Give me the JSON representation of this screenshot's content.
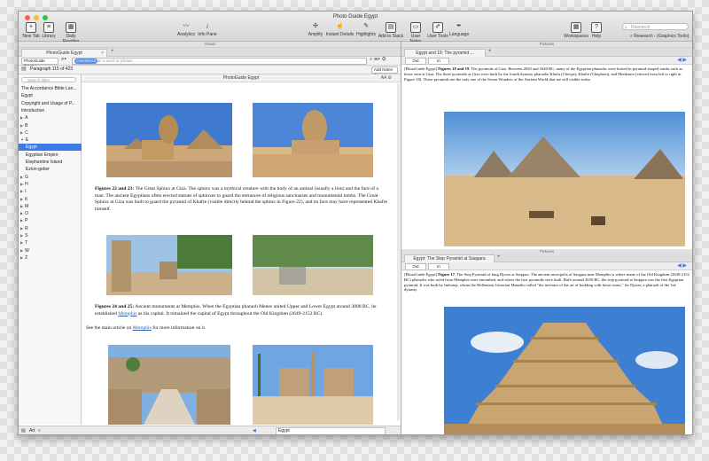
{
  "window": {
    "title": "Photo Guide Egypt"
  },
  "toolbar": {
    "new_tab": "New Tab",
    "library": "Library",
    "daily_reading": "Daily Reading",
    "analytics": "Analytics",
    "info_pane": "Info Pane",
    "amplify": "Amplify",
    "instant_details": "Instant Details",
    "highlights": "Highlights",
    "add_to_stack": "Add to Stack",
    "user_notes": "User Notes",
    "user_tools": "User Tools",
    "language": "Language",
    "workspaces": "Workspaces",
    "help": "Help",
    "search_placeholder": "Research",
    "research_crumb": "Research - (Graphics Tools)"
  },
  "left_band": "Visual",
  "right_band": "Pictures",
  "tab": {
    "label": "PhotoGuide Egypt"
  },
  "searchbar": {
    "module": "PhotoGuide Egypt",
    "scope": "CONTENTS",
    "placeholder": "Enter a word or phrase"
  },
  "location": {
    "text": "Paragraph 115 of 423",
    "add_notes": "Add Notes"
  },
  "sidebar": {
    "search": "Search titles",
    "items": [
      {
        "label": "The Accordance Bible Lan...",
        "arrow": ""
      },
      {
        "label": "Egypt",
        "arrow": ""
      },
      {
        "label": "Copyright and Usage of P...",
        "arrow": ""
      },
      {
        "label": "Introduction",
        "arrow": ""
      },
      {
        "label": "A",
        "arrow": "▶"
      },
      {
        "label": "B",
        "arrow": "▶"
      },
      {
        "label": "C",
        "arrow": "▶"
      },
      {
        "label": "E",
        "arrow": "▼"
      },
      {
        "label": "Egypt",
        "arrow": ""
      },
      {
        "label": "Egyptian Empire",
        "arrow": ""
      },
      {
        "label": "Elephantine Island",
        "arrow": ""
      },
      {
        "label": "Ezion-geber",
        "arrow": ""
      },
      {
        "label": "G",
        "arrow": "▶"
      },
      {
        "label": "H",
        "arrow": "▶"
      },
      {
        "label": "I",
        "arrow": "▶"
      },
      {
        "label": "K",
        "arrow": "▶"
      },
      {
        "label": "M",
        "arrow": "▶"
      },
      {
        "label": "O",
        "arrow": "▶"
      },
      {
        "label": "P",
        "arrow": "▶"
      },
      {
        "label": "R",
        "arrow": "▶"
      },
      {
        "label": "S",
        "arrow": "▶"
      },
      {
        "label": "T",
        "arrow": "▶"
      },
      {
        "label": "W",
        "arrow": "▶"
      },
      {
        "label": "Z",
        "arrow": "▶"
      }
    ]
  },
  "doc": {
    "header": "PhotoGuide Egypt",
    "fig22_label": "Figures 22 and 23:",
    "fig22_text": " The Great Sphinx at Giza. The sphinx was a mythical creature with the body of an animal (usually a lion) and the face of a man. The ancient Egyptians often erected statues of sphinxes to guard the entrances of religious sanctuaries and monumental tombs. The Great Sphinx at Giza was built to guard the pyramid of Khafre (visible directly behind the sphinx in Figure 22), and its face may have represented Khafre himself.",
    "fig24_label": "Figures 24 and 25:",
    "fig24_text_a": " Ancient monuments at Memphis. When the Egyptian pharaoh Menes united Upper and Lower Egypt around 3000 BC, he established ",
    "fig24_link": "Memphis",
    "fig24_text_b": " as his capital. It remained the capital of Egypt throughout the Old Kingdom (2649-2152 BC).",
    "see_a": "See the main article on ",
    "see_link": "Memphis",
    "see_b": " for more information on it."
  },
  "status": {
    "art": "Art",
    "location": "Egypt"
  },
  "pane1": {
    "tab": "Egypt and 19: The pyramid ...",
    "out": "Out",
    "in": "In",
    "source": "[PhotoGuide Egypt]",
    "label": "Figures 18 and 19",
    "text": ": The pyramids at Giza. Between 2630 and 1640 BC, many of the Egyptian pharaohs were buried in pyramid-shaped tombs such as those seen at Giza. The three pyramids at Giza were built by the fourth dynasty pharaohs Khufu (Cheops), Khafre (Chephren), and Menkaure (viewed from left to right in Figure 18). These pyramids are the only one of the Seven Wonders of the Ancient World that are still visible today."
  },
  "pane2": {
    "band": "Pictures",
    "tab": "Egypt: The Step Pyramid at Saqqara",
    "out": "Out",
    "in": "In",
    "source": "[PhotoGuide Egypt]",
    "label": "Figure 17",
    "text": ": The Step Pyramid of king Djoser at Saqqara. The ancient necropolis of Saqqara near Memphis is where many of the Old Kingdom (2649-2152 BC) pharaohs who ruled from Memphis were entombed, and where the first pyramids were built. Built around 2650 BC, the step pyramid at Saqqara was the first Egyptian pyramid. It was built by Imhotep, whom the Hellenistic historian Manetho called \"the inventor of the art of building with hewn stone,\" for Djoser, a pharaoh of the 3rd dynasty."
  },
  "colors": {
    "accent": "#3b7be6",
    "link": "#2a5db0",
    "sky": "#4f8fd6",
    "sand": "#d8b98a"
  }
}
